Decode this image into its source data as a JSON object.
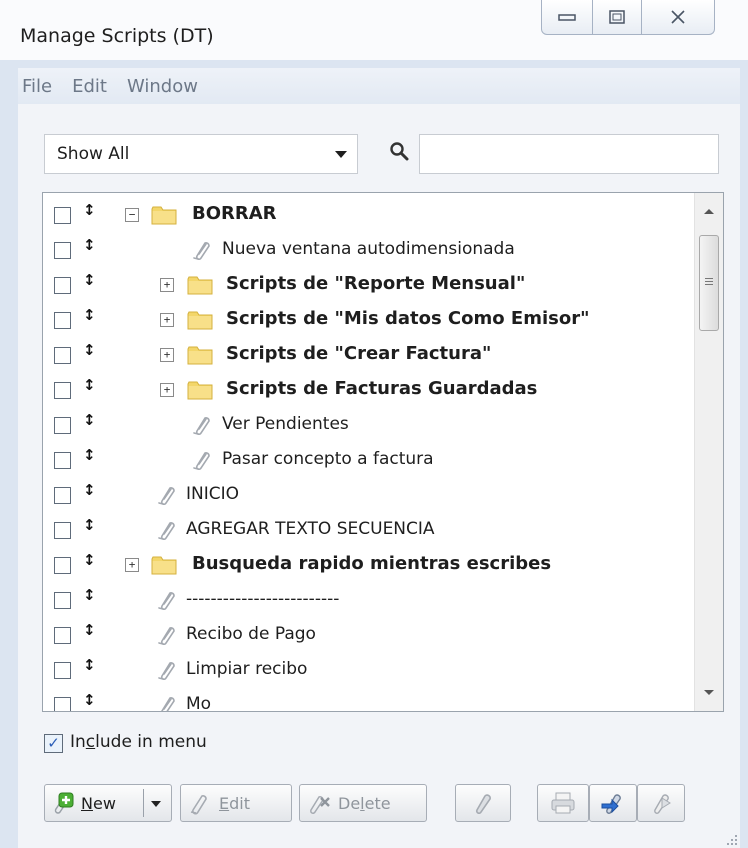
{
  "window": {
    "title": "Manage Scripts (DT)"
  },
  "menubar": {
    "items": [
      "File",
      "Edit",
      "Window"
    ]
  },
  "filter": {
    "selected": "Show All",
    "search_value": ""
  },
  "tree": {
    "rows": [
      {
        "label": "BORRAR",
        "type": "folder",
        "expander": "−",
        "level": 2
      },
      {
        "label": "Nueva ventana autodimensionada",
        "type": "script",
        "level": 3
      },
      {
        "label": "Scripts de \"Reporte Mensual\"",
        "type": "folder",
        "expander": "+",
        "level": 3
      },
      {
        "label": "Scripts de \"Mis datos Como Emisor\"",
        "type": "folder",
        "expander": "+",
        "level": 3
      },
      {
        "label": "Scripts de \"Crear Factura\"",
        "type": "folder",
        "expander": "+",
        "level": 3
      },
      {
        "label": "Scripts de Facturas Guardadas",
        "type": "folder",
        "expander": "+",
        "level": 3
      },
      {
        "label": "Ver Pendientes",
        "type": "script",
        "level": 3
      },
      {
        "label": "Pasar concepto a factura",
        "type": "script",
        "level": 3
      },
      {
        "label": "INICIO",
        "type": "script",
        "level": 2
      },
      {
        "label": "AGREGAR TEXTO SECUENCIA",
        "type": "script",
        "level": 2
      },
      {
        "label": "Busqueda rapido mientras escribes",
        "type": "folder",
        "expander": "+",
        "level": 2
      },
      {
        "label": "-------------------------",
        "type": "script",
        "level": 2
      },
      {
        "label": "Recibo de Pago",
        "type": "script",
        "level": 2
      },
      {
        "label": "Limpiar recibo",
        "type": "script",
        "level": 2
      },
      {
        "label": "Mo",
        "type": "script",
        "level": 2
      }
    ]
  },
  "include_in_menu": {
    "label_pre": "In",
    "label_ul": "c",
    "label_post": "lude in menu",
    "checked": true
  },
  "toolbar": {
    "new_label_ul": "N",
    "new_label_rest": "ew",
    "edit_label_ul": "E",
    "edit_label_rest": "dit",
    "delete_label_pre": "De",
    "delete_label_ul": "l",
    "delete_label_post": "ete"
  },
  "colors": {
    "folder": "#f3d66a",
    "accent": "#2a5db8",
    "add": "#3e9a2e"
  }
}
